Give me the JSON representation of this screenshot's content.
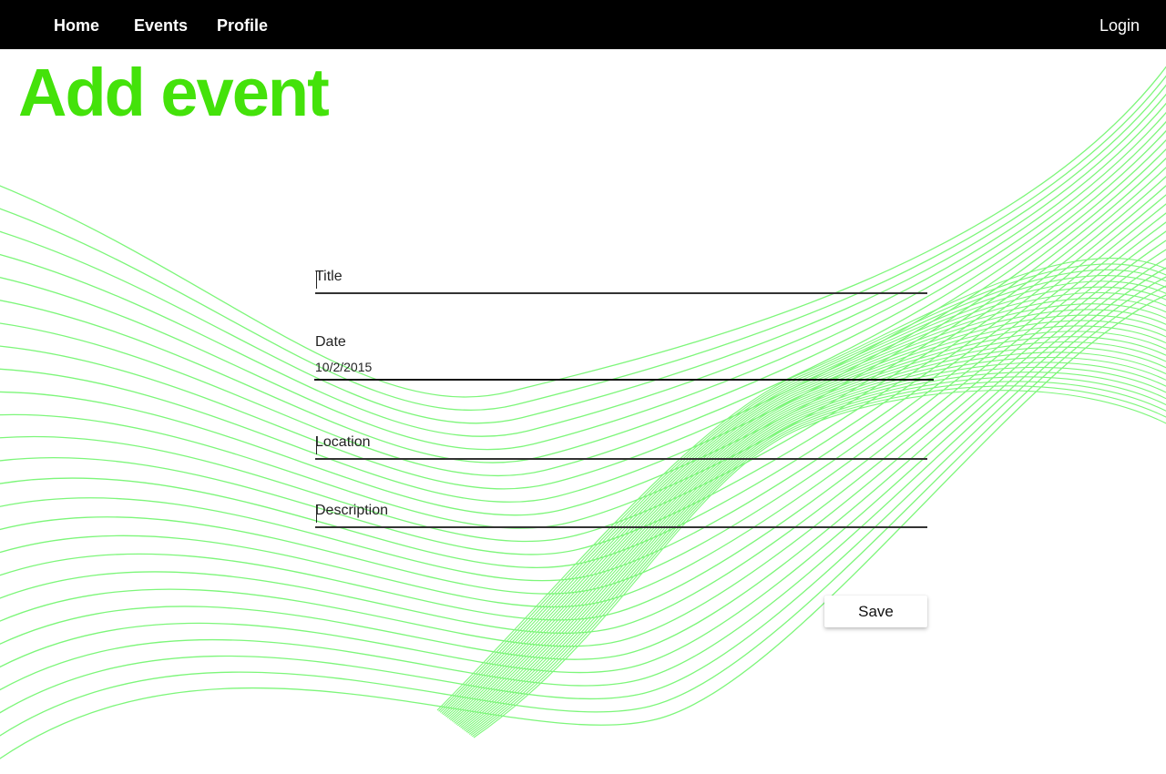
{
  "nav": {
    "home": "Home",
    "events": "Events",
    "profile": "Profile",
    "login": "Login"
  },
  "page": {
    "title": "Add event"
  },
  "form": {
    "title": {
      "placeholder": "Title",
      "value": ""
    },
    "date": {
      "label": "Date",
      "value": "10/2/2015"
    },
    "location": {
      "placeholder": "Location",
      "value": ""
    },
    "description": {
      "placeholder": "Description",
      "value": ""
    },
    "save_label": "Save"
  },
  "colors": {
    "accent": "#44e20a",
    "wave": "#7df67a",
    "navbar": "#000000"
  }
}
